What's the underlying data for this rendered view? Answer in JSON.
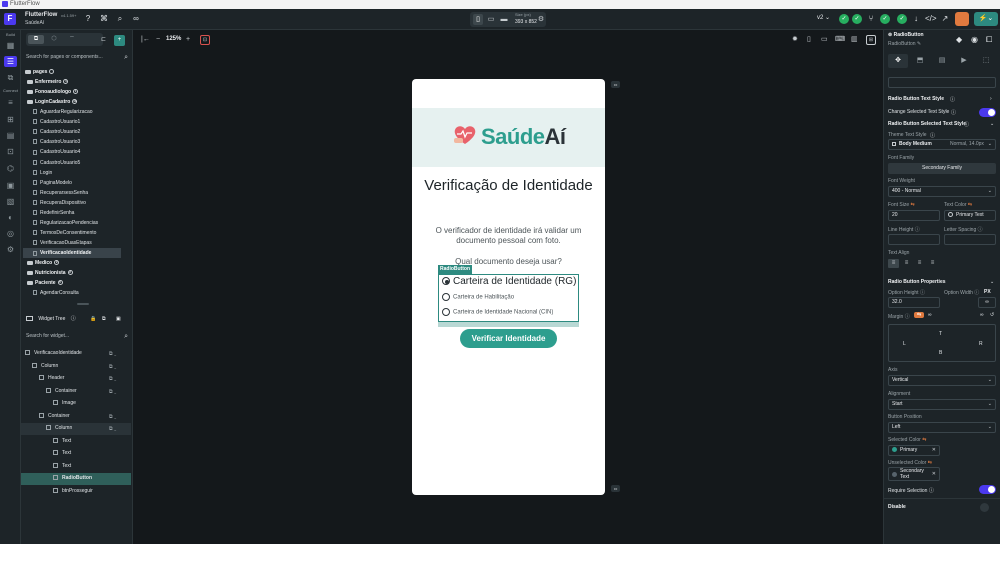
{
  "os": {
    "title": "FlutterFlow"
  },
  "topbar": {
    "brand": "FlutterFlow",
    "version": "v4.1.59+",
    "project": "SaúdeAí",
    "device_size_label": "Size (px)",
    "device_size": "393 x 852",
    "version_select": "v2",
    "icons": [
      "help-icon",
      "command-icon",
      "search-icon",
      "link-icon"
    ]
  },
  "rail": {
    "build_label": "Build",
    "connect_label": "Connect"
  },
  "left": {
    "search_pages_placeholder": "Search for pages or components...",
    "tree": {
      "pages": "pages",
      "groups": [
        {
          "label": "Enfermeiro",
          "count": "1"
        },
        {
          "label": "Fonoaudiologo",
          "count": "1"
        },
        {
          "label": "LoginCadastro",
          "count": "18"
        }
      ],
      "login_pages": [
        "AguardarRegularizacao",
        "CadastroUsuario1",
        "CadastroUsuario2",
        "CadastroUsuario3",
        "CadastroUsuario4",
        "CadastroUsuario5",
        "Login",
        "PaginaModelo",
        "RecuperarsessSenha",
        "RecuperaDispositivo",
        "RedefinirSenha",
        "RegularizacaoPendencias",
        "TermosDeConsentimento",
        "VerificacaoDuasEtapas",
        "VerificacaoIdentidade"
      ],
      "groups2": [
        {
          "label": "Medico",
          "count": "2"
        },
        {
          "label": "Nutricionista",
          "count": "2"
        },
        {
          "label": "Paciente",
          "count": "5"
        }
      ],
      "paciente_pages": [
        "AgendarConsulta"
      ]
    },
    "widget_tree_title": "Widget Tree",
    "search_widgets_placeholder": "Search for widget...",
    "widgets": [
      {
        "label": "VerificacaoIdentidade",
        "depth": 0
      },
      {
        "label": "Column",
        "depth": 1
      },
      {
        "label": "Header",
        "depth": 2
      },
      {
        "label": "Container",
        "depth": 3
      },
      {
        "label": "Image",
        "depth": 4
      },
      {
        "label": "Container",
        "depth": 2
      },
      {
        "label": "Column",
        "depth": 3
      },
      {
        "label": "Text",
        "depth": 4
      },
      {
        "label": "Text",
        "depth": 4
      },
      {
        "label": "Text",
        "depth": 4
      },
      {
        "label": "RadioButton",
        "depth": 4
      },
      {
        "label": "btnProsseguir",
        "depth": 4
      }
    ]
  },
  "canvas": {
    "zoom": "125%",
    "screen": {
      "logo_part1": "Saúde",
      "logo_part2": "Aí",
      "title": "Verificação de Identidade",
      "description": "O verificador de identidade irá validar um documento pessoal com foto.",
      "question": "Qual documento deseja usar?",
      "radio_tag": "RadioButton",
      "options": [
        "Carteira de Identidade (RG)",
        "Carteira de Habilitação",
        "Carteira de Identidade Nacional (CIN)"
      ],
      "selected_index": 0,
      "cta": "Verificar Identidade"
    }
  },
  "right": {
    "widget_type": "RadioButton",
    "widget_name": "RadioButton",
    "section_text_style": "Radio Button Text Style",
    "change_selected_text_style": "Change Selected Text Style",
    "selected_text_style": "Radio Button Selected Text Style",
    "theme_text_style_label": "Theme Text Style",
    "theme_text_style_value": "Body Medium",
    "theme_text_style_meta": "Normal, 14.0px",
    "font_family_label": "Font Family",
    "font_family_value": "Secondary Family",
    "font_weight_label": "Font Weight",
    "font_weight_value": "400 - Normal",
    "font_size_label": "Font Size",
    "font_size_value": "20",
    "text_color_label": "Text Color",
    "text_color_value": "Primary Text",
    "line_height_label": "Line Height",
    "letter_spacing_label": "Letter Spacing",
    "text_align_label": "Text Align",
    "props_title": "Radio Button Properties",
    "option_height_label": "Option Height",
    "option_height_value": "32.0",
    "option_width_label": "Option Width",
    "option_width_unit": "PX",
    "option_width_value": "∞",
    "margin_label": "Margin",
    "margin_t": "T",
    "margin_l": "L",
    "margin_r": "R",
    "margin_b": "B",
    "axis_label": "Axis",
    "axis_value": "Vertical",
    "alignment_label": "Alignment",
    "alignment_value": "Start",
    "button_position_label": "Button Position",
    "button_position_value": "Left",
    "selected_color_label": "Selected Color",
    "selected_color_value": "Primary",
    "unselected_color_label": "Unselected Color",
    "unselected_color_value": "Secondary Text",
    "require_selection_label": "Require Selection",
    "disable_label": "Disable"
  },
  "colors": {
    "accent": "#4b39ef",
    "teal": "#2d9e8e",
    "primary": "#2d9e8e",
    "secondary_text": "#57636c",
    "panel": "#1d2428",
    "canvas": "#14181b"
  }
}
